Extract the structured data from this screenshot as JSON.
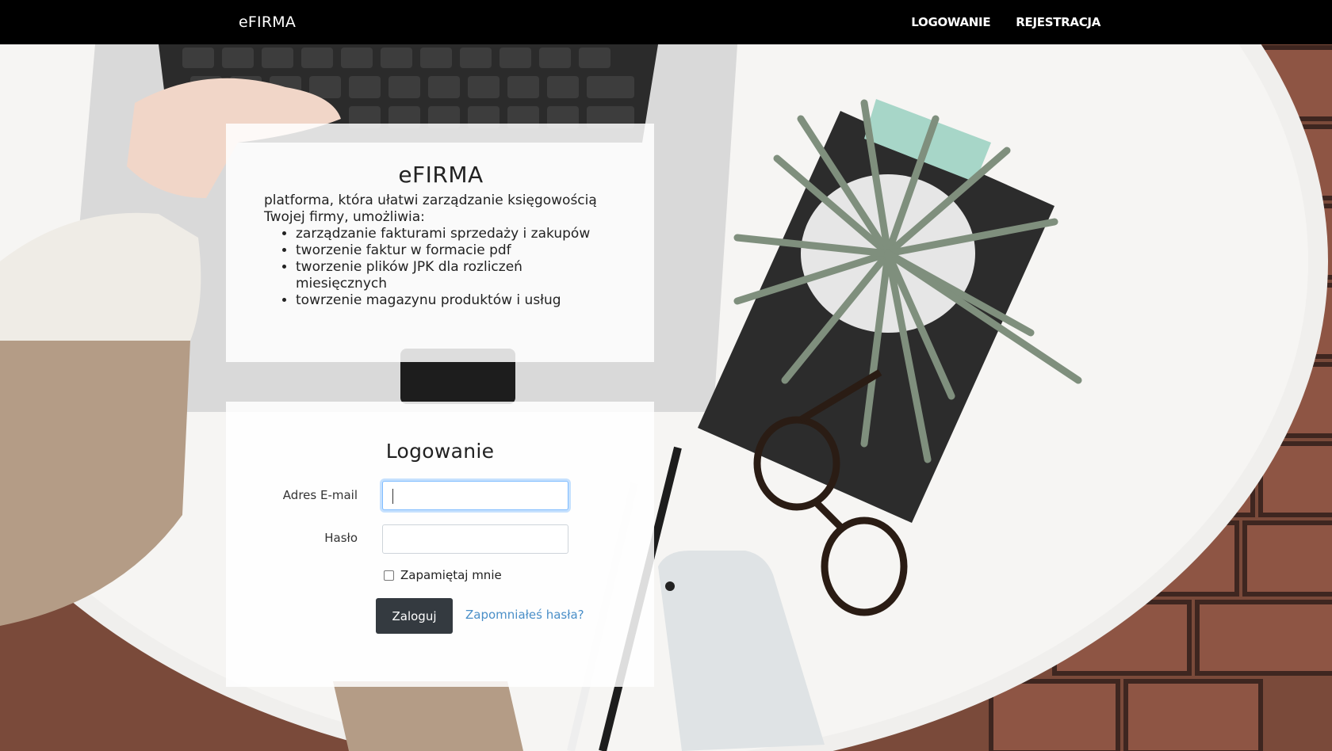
{
  "navbar": {
    "brand": "eFIRMA",
    "links": [
      "LOGOWANIE",
      "REJESTRACJA"
    ]
  },
  "info": {
    "title": "eFIRMA",
    "description": "platforma, która ułatwi zarządzanie księgowością Twojej firmy, umożliwia:",
    "features": [
      "zarządzanie fakturami sprzedaży i zakupów",
      "tworzenie faktur w formacie pdf",
      "tworzenie plików JPK dla rozliczeń miesięcznych",
      "towrzenie magazynu produktów i usług"
    ]
  },
  "login": {
    "title": "Logowanie",
    "email_label": "Adres E-mail",
    "email_value": "",
    "password_label": "Hasło",
    "password_value": "",
    "remember_label": "Zapamiętaj mnie",
    "remember_checked": false,
    "submit_label": "Zaloguj",
    "forgot_label": "Zapomniałeś hasła?"
  },
  "colors": {
    "navbar": "#000000",
    "button": "#343a40",
    "link": "#4a8fc8",
    "focus": "#80bdff"
  }
}
